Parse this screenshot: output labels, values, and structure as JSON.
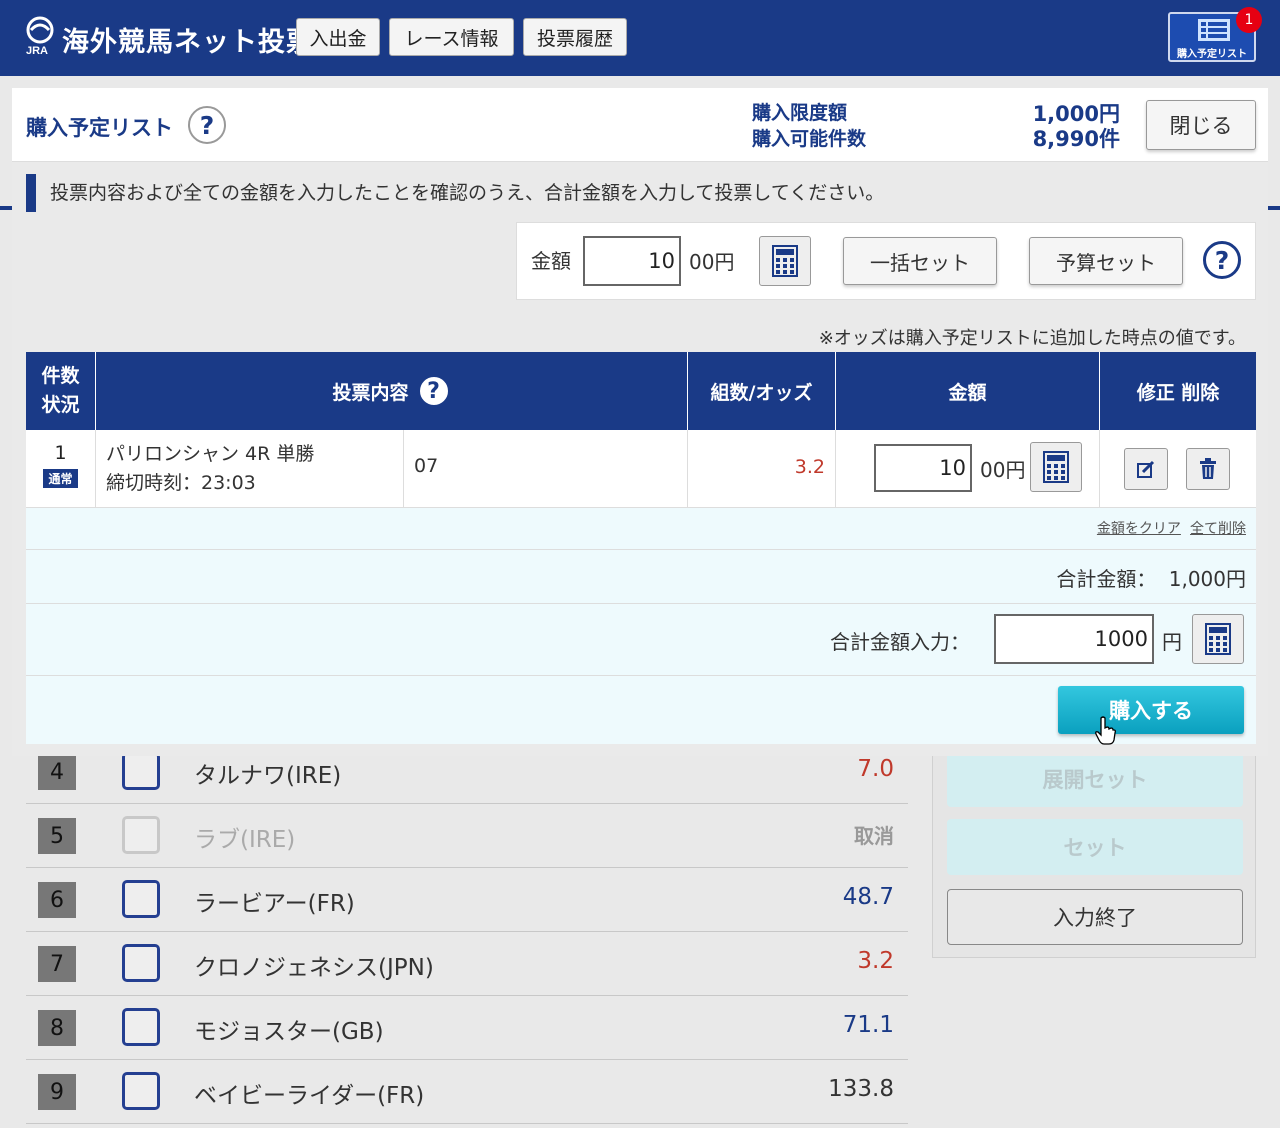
{
  "header": {
    "app_title": "海外競馬ネット投票",
    "logo_text": "JRA",
    "nav": [
      "入出金",
      "レース情報",
      "投票履歴"
    ],
    "list_button_label": "購入予定リスト",
    "list_badge": "1"
  },
  "background": {
    "runners": [
      {
        "num": "4",
        "name": "タルナワ(IRE)",
        "odds": "7.0",
        "odds_color": "#c0392b",
        "scratched": false
      },
      {
        "num": "5",
        "name": "ラブ(IRE)",
        "odds": "取消",
        "odds_color": "#999999",
        "scratched": true
      },
      {
        "num": "6",
        "name": "ラービアー(FR)",
        "odds": "48.7",
        "odds_color": "#1a3a87",
        "scratched": false
      },
      {
        "num": "7",
        "name": "クロノジェネシス(JPN)",
        "odds": "3.2",
        "odds_color": "#c0392b",
        "scratched": false
      },
      {
        "num": "8",
        "name": "モジョスター(GB)",
        "odds": "71.1",
        "odds_color": "#1a3a87",
        "scratched": false
      },
      {
        "num": "9",
        "name": "ベイビーライダー(FR)",
        "odds": "133.8",
        "odds_color": "#333333",
        "scratched": false
      }
    ],
    "side_buttons": [
      "展開セット",
      "セット",
      "入力終了"
    ]
  },
  "modal": {
    "title": "購入予定リスト",
    "help": "?",
    "limit_amount_label": "購入限度額",
    "limit_amount_value": "1,000円",
    "limit_count_label": "購入可能件数",
    "limit_count_value": "8,990件",
    "close_label": "閉じる",
    "notice": "投票内容および全ての金額を入力したことを確認のうえ、合計金額を入力して投票してください。",
    "amount_label": "金額",
    "amount_value": "10",
    "amount_unit": "00円",
    "bulk_set_label": "一括セット",
    "budget_set_label": "予算セット",
    "odds_note": "※オッズは購入予定リストに追加した時点の値です。",
    "table": {
      "headers": {
        "count_status": [
          "件数",
          "状況"
        ],
        "content": "投票内容",
        "odds": "組数/オッズ",
        "amount": "金額",
        "edit_delete": "修正 削除"
      },
      "rows": [
        {
          "index": "1",
          "status": "通常",
          "race": "パリロンシャン 4R 単勝",
          "deadline": "締切時刻：23:03",
          "selection": "07",
          "odds": "3.2",
          "amount": "10",
          "unit": "00円"
        }
      ]
    },
    "clear_amount_link": "金額をクリア",
    "delete_all_link": "全て削除",
    "total_label": "合計金額：",
    "total_value": "1,000円",
    "total_input_label": "合計金額入力：",
    "total_input_value": "1000",
    "total_input_unit": "円",
    "buy_label": "購入する"
  },
  "colors": {
    "primary": "#1a3a87",
    "buy": "#13aecb",
    "odds_red": "#c0392b"
  }
}
